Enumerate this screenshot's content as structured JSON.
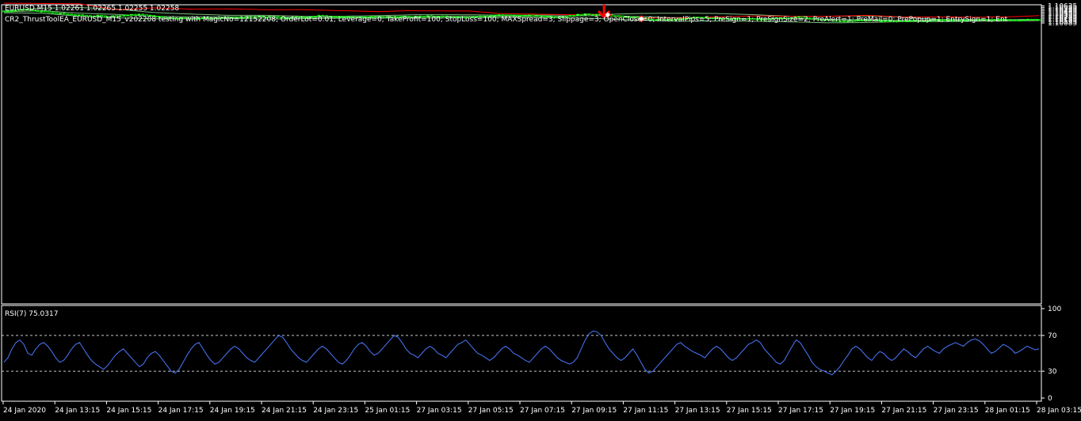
{
  "header": {
    "symbol_line": "EURUSD,M15  1.02261 1.02265 1.02255 1.02258",
    "ea_line": "CR2_ThrustToolEA_EURUSD_M15_v202208 testing with MagicNo=12152208; OrderLot=0.01; Leverage=0; TakeProfit=100; StopLoss=100; MAXSpread=3; Slippage=3; OpenClose=0; IntervalPips=5; PreSign=1; PreSignSize=2; PreAlert=1; PreMail=0; PrePopup=1; EntrySign=1; Ent"
  },
  "rsi_label": "RSI(7) 75.0317",
  "colors": {
    "background": "#000000",
    "frame": "#ffffff",
    "bull_candle": "#ffffff",
    "bear_candle": "#000000",
    "candle_outline": "#00ff00",
    "bands": "#7fbf7f",
    "red_line": "#ff0000",
    "rsi_line": "#4a78ff",
    "signal_arrow": "#ff0000"
  },
  "chart_data": [
    {
      "type": "candlestick",
      "ylim": [
        1.0107,
        1.1067
      ],
      "y_ticks": [
        "1.10635",
        "1.10585",
        "1.10535",
        "1.10485",
        "1.10435",
        "1.10385",
        "1.10335",
        "1.10285",
        "1.10235",
        "1.10185",
        "1.10135",
        "1.10085"
      ],
      "x_ticks": [
        "24 Jan 2020",
        "24 Jan 13:15",
        "24 Jan 15:15",
        "24 Jan 17:15",
        "24 Jan 19:15",
        "24 Jan 21:15",
        "24 Jan 23:15",
        "25 Jan 01:15",
        "27 Jan 03:15",
        "27 Jan 05:15",
        "27 Jan 07:15",
        "27 Jan 09:15",
        "27 Jan 11:15",
        "27 Jan 13:15",
        "27 Jan 15:15",
        "27 Jan 17:15",
        "27 Jan 19:15",
        "27 Jan 21:15",
        "27 Jan 23:15",
        "28 Jan 01:15",
        "28 Jan 03:15"
      ],
      "close_anchors": [
        [
          0,
          1.1047
        ],
        [
          6,
          1.1053
        ],
        [
          12,
          1.1042
        ],
        [
          20,
          1.1033
        ],
        [
          28,
          1.103
        ],
        [
          36,
          1.1036
        ],
        [
          44,
          1.1025
        ],
        [
          52,
          1.1023
        ],
        [
          60,
          1.1025
        ],
        [
          68,
          1.1029
        ],
        [
          76,
          1.1026
        ],
        [
          84,
          1.1031
        ],
        [
          92,
          1.1027
        ],
        [
          100,
          1.1028
        ],
        [
          108,
          1.103
        ],
        [
          116,
          1.1029
        ],
        [
          124,
          1.1028
        ],
        [
          132,
          1.1034
        ],
        [
          140,
          1.1032
        ],
        [
          148,
          1.1029
        ],
        [
          152,
          1.1034
        ],
        [
          158,
          1.1038
        ],
        [
          164,
          1.1029
        ],
        [
          170,
          1.1024
        ],
        [
          172,
          1.1018
        ],
        [
          178,
          1.1021
        ],
        [
          184,
          1.1026
        ],
        [
          192,
          1.1022
        ],
        [
          198,
          1.1021
        ],
        [
          206,
          1.1024
        ],
        [
          212,
          1.1027
        ],
        [
          216,
          1.1021
        ],
        [
          220,
          1.1016
        ],
        [
          224,
          1.1014
        ],
        [
          230,
          1.1019
        ],
        [
          236,
          1.1014
        ],
        [
          244,
          1.1016
        ],
        [
          252,
          1.1017
        ],
        [
          260,
          1.1019
        ],
        [
          268,
          1.1018
        ],
        [
          276,
          1.1019
        ]
      ],
      "bands_upper": [
        [
          0,
          1.1047
        ],
        [
          10,
          1.1056
        ],
        [
          20,
          1.1058
        ],
        [
          30,
          1.1053
        ],
        [
          40,
          1.1042
        ],
        [
          50,
          1.1037
        ],
        [
          60,
          1.1033
        ],
        [
          70,
          1.1033
        ],
        [
          80,
          1.103
        ],
        [
          90,
          1.103
        ],
        [
          100,
          1.1032
        ],
        [
          110,
          1.1035
        ],
        [
          120,
          1.1035
        ],
        [
          130,
          1.1034
        ],
        [
          140,
          1.1033
        ],
        [
          150,
          1.1035
        ],
        [
          160,
          1.1036
        ],
        [
          170,
          1.1039
        ],
        [
          180,
          1.104
        ],
        [
          190,
          1.1039
        ],
        [
          200,
          1.1035
        ],
        [
          210,
          1.103
        ],
        [
          220,
          1.103
        ],
        [
          230,
          1.1031
        ],
        [
          240,
          1.1027
        ],
        [
          248,
          1.102
        ],
        [
          260,
          1.1019
        ],
        [
          276,
          1.102
        ]
      ],
      "bands_middle": [
        [
          0,
          1.1044
        ],
        [
          10,
          1.1048
        ],
        [
          20,
          1.104
        ],
        [
          30,
          1.1036
        ],
        [
          40,
          1.103
        ],
        [
          50,
          1.1028
        ],
        [
          60,
          1.1028
        ],
        [
          70,
          1.1027
        ],
        [
          80,
          1.1026
        ],
        [
          90,
          1.1027
        ],
        [
          100,
          1.1028
        ],
        [
          110,
          1.1029
        ],
        [
          120,
          1.103
        ],
        [
          130,
          1.103
        ],
        [
          140,
          1.103
        ],
        [
          150,
          1.1031
        ],
        [
          160,
          1.1032
        ],
        [
          170,
          1.1029
        ],
        [
          180,
          1.1025
        ],
        [
          190,
          1.1024
        ],
        [
          200,
          1.1022
        ],
        [
          210,
          1.1022
        ],
        [
          220,
          1.102
        ],
        [
          230,
          1.1019
        ],
        [
          240,
          1.1017
        ],
        [
          250,
          1.1016
        ],
        [
          260,
          1.1017
        ],
        [
          276,
          1.1018
        ]
      ],
      "bands_lower": [
        [
          0,
          1.1041
        ],
        [
          10,
          1.104
        ],
        [
          20,
          1.103
        ],
        [
          30,
          1.1025
        ],
        [
          40,
          1.1022
        ],
        [
          50,
          1.1022
        ],
        [
          60,
          1.1023
        ],
        [
          70,
          1.1021
        ],
        [
          80,
          1.1022
        ],
        [
          90,
          1.1024
        ],
        [
          100,
          1.1024
        ],
        [
          110,
          1.1024
        ],
        [
          120,
          1.1025
        ],
        [
          130,
          1.1026
        ],
        [
          140,
          1.1026
        ],
        [
          150,
          1.1025
        ],
        [
          160,
          1.1022
        ],
        [
          170,
          1.1017
        ],
        [
          180,
          1.1014
        ],
        [
          190,
          1.1015
        ],
        [
          200,
          1.1014
        ],
        [
          210,
          1.1012
        ],
        [
          220,
          1.1009
        ],
        [
          230,
          1.101
        ],
        [
          240,
          1.1013
        ],
        [
          250,
          1.1013
        ],
        [
          260,
          1.1014
        ],
        [
          276,
          1.1016
        ]
      ],
      "red_line": [
        [
          0,
          1.1072
        ],
        [
          20,
          1.107
        ],
        [
          30,
          1.1051
        ],
        [
          40,
          1.1057
        ],
        [
          50,
          1.1053
        ],
        [
          60,
          1.1054
        ],
        [
          70,
          1.1051
        ],
        [
          80,
          1.1051
        ],
        [
          90,
          1.1048
        ],
        [
          100,
          1.1045
        ],
        [
          108,
          1.1048
        ],
        [
          118,
          1.1047
        ],
        [
          124,
          1.1047
        ],
        [
          132,
          1.1039
        ],
        [
          140,
          1.1037
        ],
        [
          150,
          1.1035
        ],
        [
          158,
          1.1036
        ],
        [
          164,
          1.1029
        ],
        [
          170,
          1.1025
        ],
        [
          180,
          1.1024
        ],
        [
          190,
          1.1028
        ],
        [
          200,
          1.1031
        ],
        [
          210,
          1.103
        ],
        [
          220,
          1.103
        ],
        [
          230,
          1.1033
        ],
        [
          240,
          1.1028
        ],
        [
          250,
          1.1028
        ],
        [
          260,
          1.1027
        ],
        [
          270,
          1.1029
        ],
        [
          276,
          1.1032
        ]
      ],
      "signal_arrow": {
        "bar": 160,
        "price": 1.1042,
        "direction": "down"
      },
      "markers": [
        {
          "bar": 161,
          "price": 1.1035
        },
        {
          "bar": 170,
          "price": 1.1022
        }
      ]
    },
    {
      "type": "line",
      "name": "RSI(7)",
      "ylim": [
        0,
        100
      ],
      "y_ticks": [
        100,
        70,
        30,
        0
      ],
      "levels": [
        70,
        30
      ],
      "values": [
        40,
        45,
        55,
        62,
        65,
        60,
        50,
        48,
        55,
        60,
        62,
        58,
        52,
        45,
        40,
        42,
        48,
        55,
        60,
        62,
        55,
        48,
        42,
        38,
        35,
        32,
        36,
        42,
        48,
        52,
        55,
        50,
        45,
        40,
        35,
        38,
        45,
        50,
        52,
        48,
        42,
        36,
        30,
        28,
        32,
        40,
        48,
        55,
        60,
        62,
        55,
        48,
        42,
        38,
        40,
        45,
        50,
        55,
        58,
        55,
        50,
        45,
        42,
        40,
        45,
        50,
        55,
        60,
        65,
        70,
        68,
        62,
        55,
        50,
        45,
        42,
        40,
        45,
        50,
        55,
        58,
        55,
        50,
        45,
        40,
        38,
        42,
        48,
        55,
        60,
        62,
        58,
        52,
        48,
        50,
        55,
        60,
        65,
        70,
        68,
        62,
        55,
        50,
        48,
        45,
        50,
        55,
        58,
        55,
        50,
        48,
        45,
        50,
        55,
        60,
        62,
        65,
        60,
        55,
        50,
        48,
        45,
        42,
        45,
        50,
        55,
        58,
        55,
        50,
        48,
        45,
        42,
        40,
        45,
        50,
        55,
        58,
        55,
        50,
        45,
        42,
        40,
        38,
        40,
        45,
        55,
        65,
        72,
        75,
        74,
        70,
        62,
        55,
        50,
        45,
        42,
        45,
        50,
        55,
        48,
        40,
        32,
        28,
        30,
        35,
        40,
        45,
        50,
        55,
        60,
        62,
        58,
        55,
        52,
        50,
        48,
        45,
        50,
        55,
        58,
        55,
        50,
        45,
        42,
        45,
        50,
        55,
        60,
        62,
        65,
        62,
        55,
        50,
        45,
        40,
        38,
        42,
        50,
        58,
        65,
        62,
        55,
        48,
        40,
        35,
        32,
        30,
        28,
        26,
        30,
        35,
        42,
        48,
        55,
        58,
        55,
        50,
        45,
        42,
        48,
        52,
        50,
        45,
        42,
        45,
        50,
        55,
        52,
        48,
        45,
        50,
        55,
        58,
        55,
        52,
        50,
        55,
        58,
        60,
        62,
        60,
        58,
        62,
        65,
        66,
        64,
        60,
        55,
        50,
        52,
        56,
        60,
        58,
        55,
        50,
        52,
        55,
        58,
        56,
        54,
        55
      ]
    }
  ]
}
